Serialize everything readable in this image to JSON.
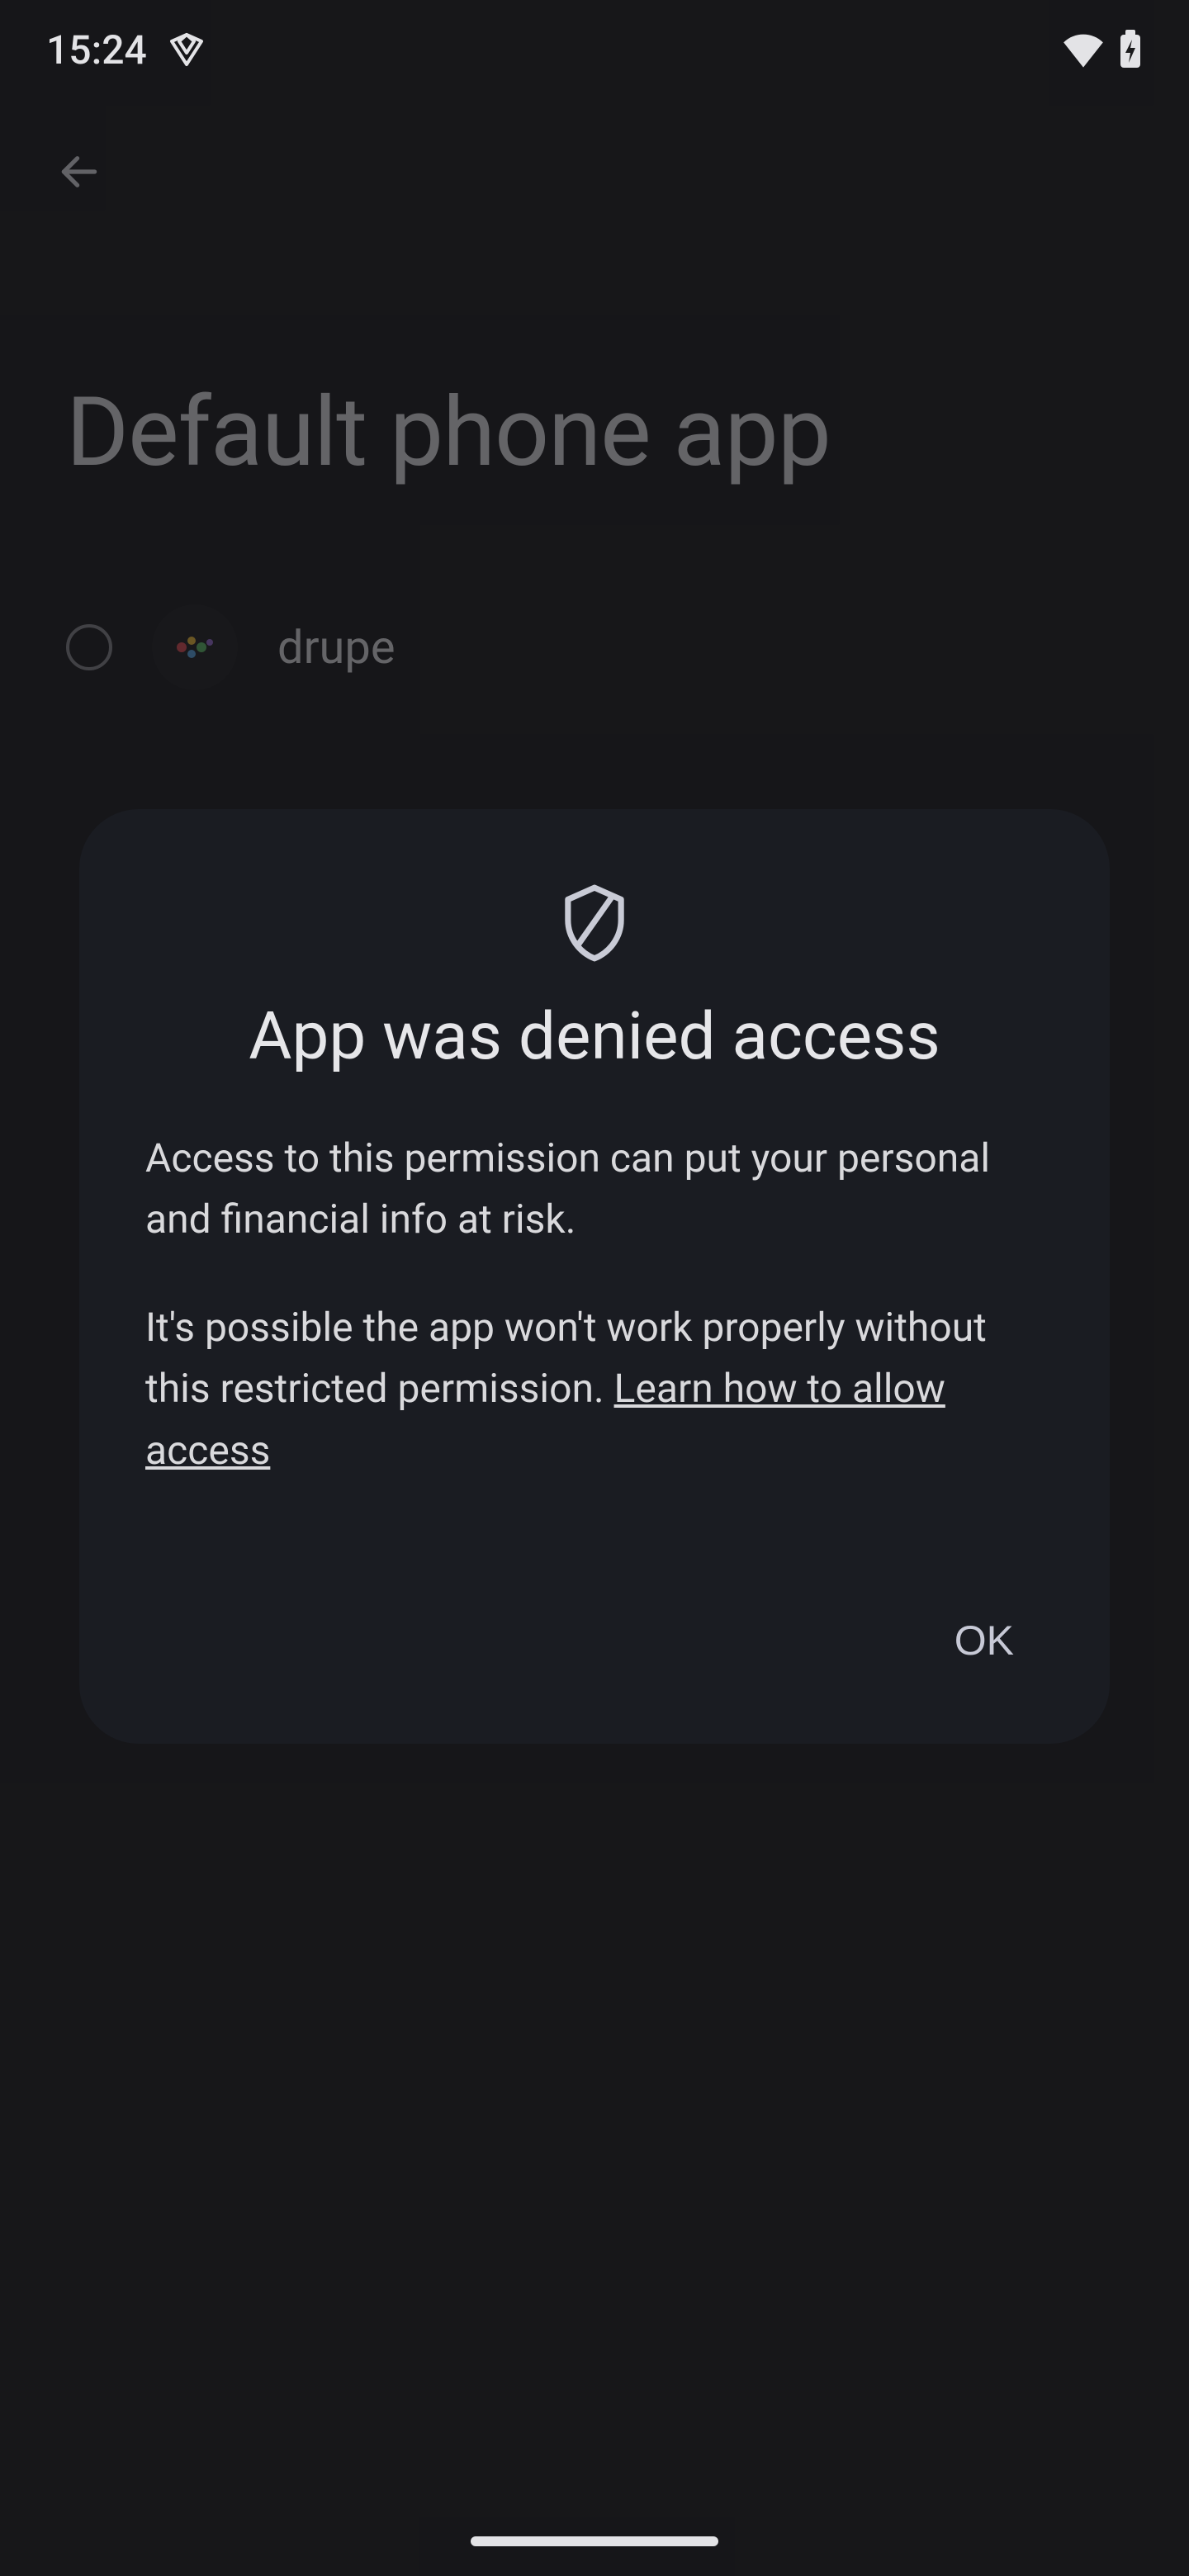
{
  "status_bar": {
    "time": "15:24",
    "vpn_icon": "vpn-shield-icon",
    "wifi_icon": "wifi-icon",
    "battery_icon": "battery-charging-icon"
  },
  "page": {
    "title": "Default phone app",
    "options": [
      {
        "label": "drupe",
        "selected": false,
        "icon": "drupe-app-icon"
      }
    ]
  },
  "dialog": {
    "icon": "shield-icon",
    "title": "App was denied access",
    "body_p1": "Access to this permission can put your personal and financial info at risk.",
    "body_p2_prefix": "It's possible the app won't work properly without this restricted permission. ",
    "body_p2_link": "Learn how to allow access",
    "ok_label": "OK"
  }
}
